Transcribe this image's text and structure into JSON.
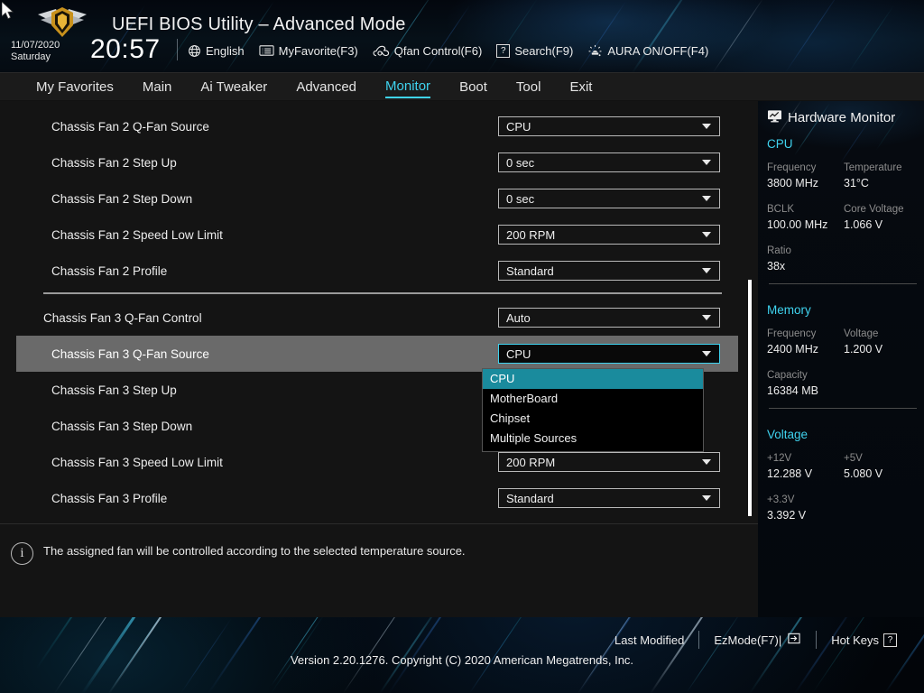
{
  "header": {
    "title": "UEFI BIOS Utility – Advanced Mode",
    "date": "11/07/2020",
    "weekday": "Saturday",
    "time": "20:57",
    "gear_icon": "gear-icon",
    "logo": "tuf-gaming-logo",
    "toolbar": [
      {
        "label": "English",
        "icon": "globe-icon"
      },
      {
        "label": "MyFavorite(F3)",
        "icon": "list-icon"
      },
      {
        "label": "Qfan Control(F6)",
        "icon": "fan-icon"
      },
      {
        "label": "Search(F9)",
        "icon": "question-box-icon"
      },
      {
        "label": "AURA ON/OFF(F4)",
        "icon": "aura-light-icon"
      }
    ]
  },
  "nav": {
    "tabs": [
      {
        "label": "My Favorites",
        "active": false
      },
      {
        "label": "Main",
        "active": false
      },
      {
        "label": "Ai Tweaker",
        "active": false
      },
      {
        "label": "Advanced",
        "active": false
      },
      {
        "label": "Monitor",
        "active": true
      },
      {
        "label": "Boot",
        "active": false
      },
      {
        "label": "Tool",
        "active": false
      },
      {
        "label": "Exit",
        "active": false
      }
    ],
    "accent": "#3fd3ef"
  },
  "settings": {
    "rows": [
      {
        "label": "Chassis Fan 2 Q-Fan Source",
        "value": "CPU",
        "selected": false,
        "indent": true,
        "focused": false
      },
      {
        "label": "Chassis Fan 2 Step Up",
        "value": "0 sec",
        "selected": false,
        "indent": true,
        "focused": false
      },
      {
        "label": "Chassis Fan 2 Step Down",
        "value": "0 sec",
        "selected": false,
        "indent": true,
        "focused": false
      },
      {
        "label": "Chassis Fan 2 Speed Low Limit",
        "value": "200 RPM",
        "selected": false,
        "indent": true,
        "focused": false
      },
      {
        "label": "Chassis Fan 2 Profile",
        "value": "Standard",
        "selected": false,
        "indent": true,
        "focused": false
      },
      {
        "label": "Chassis Fan 3 Q-Fan Control",
        "value": "Auto",
        "selected": false,
        "indent": false,
        "focused": false
      },
      {
        "label": "Chassis Fan 3 Q-Fan Source",
        "value": "CPU",
        "selected": true,
        "indent": true,
        "focused": true
      },
      {
        "label": "Chassis Fan 3 Step Up",
        "value": "",
        "selected": false,
        "indent": true,
        "focused": false
      },
      {
        "label": "Chassis Fan 3 Step Down",
        "value": "",
        "selected": false,
        "indent": true,
        "focused": false
      },
      {
        "label": "Chassis Fan 3 Speed Low Limit",
        "value": "200 RPM",
        "selected": false,
        "indent": true,
        "focused": false
      },
      {
        "label": "Chassis Fan 3 Profile",
        "value": "Standard",
        "selected": false,
        "indent": true,
        "focused": false
      }
    ]
  },
  "dropdown": {
    "open": true,
    "selected": "CPU",
    "highlight_color": "#1a8b9d",
    "options": [
      "CPU",
      "MotherBoard",
      "Chipset",
      "Multiple Sources"
    ]
  },
  "help": {
    "icon": "info-icon",
    "text": "The assigned fan will be controlled according to the selected temperature source."
  },
  "sidebar": {
    "title": "Hardware Monitor",
    "title_icon": "monitor-icon",
    "sections": [
      {
        "name": "CPU",
        "pairs": [
          [
            {
              "key": "Frequency",
              "value": "3800 MHz"
            },
            {
              "key": "Temperature",
              "value": "31°C"
            }
          ],
          [
            {
              "key": "BCLK",
              "value": "100.00 MHz"
            },
            {
              "key": "Core Voltage",
              "value": "1.066 V"
            }
          ],
          [
            {
              "key": "Ratio",
              "value": "38x"
            }
          ]
        ]
      },
      {
        "name": "Memory",
        "pairs": [
          [
            {
              "key": "Frequency",
              "value": "2400 MHz"
            },
            {
              "key": "Voltage",
              "value": "1.200 V"
            }
          ],
          [
            {
              "key": "Capacity",
              "value": "16384 MB"
            }
          ]
        ]
      },
      {
        "name": "Voltage",
        "pairs": [
          [
            {
              "key": "+12V",
              "value": "12.288 V"
            },
            {
              "key": "+5V",
              "value": "5.080 V"
            }
          ],
          [
            {
              "key": "+3.3V",
              "value": "3.392 V"
            }
          ]
        ]
      }
    ]
  },
  "footer": {
    "links": [
      {
        "label": "Last Modified",
        "icon": ""
      },
      {
        "label": "EzMode(F7)|",
        "icon": "enter-arrow-icon"
      },
      {
        "label": "Hot Keys",
        "icon": "question-box-icon"
      }
    ],
    "version": "Version 2.20.1276. Copyright (C) 2020 American Megatrends, Inc."
  }
}
